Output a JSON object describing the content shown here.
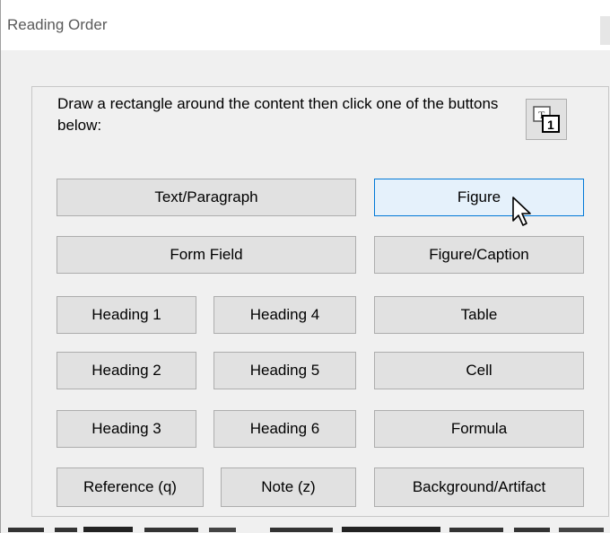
{
  "window": {
    "title": "Reading Order"
  },
  "instruction": "Draw a rectangle around the content then click one of the buttons below:",
  "mode_button": {
    "icon": "text-order-icon"
  },
  "buttons": {
    "text_paragraph": "Text/Paragraph",
    "figure": "Figure",
    "form_field": "Form Field",
    "figure_caption": "Figure/Caption",
    "heading_1": "Heading 1",
    "heading_4": "Heading 4",
    "table": "Table",
    "heading_2": "Heading 2",
    "heading_5": "Heading 5",
    "cell": "Cell",
    "heading_3": "Heading 3",
    "heading_6": "Heading 6",
    "formula": "Formula",
    "reference": "Reference (q)",
    "note": "Note (z)",
    "background_artifact": "Background/Artifact"
  },
  "colors": {
    "dialog_bg": "#f0f0f0",
    "button_bg": "#e1e1e1",
    "button_border": "#adadad",
    "hover_bg": "#e5f1fb",
    "hover_border": "#0078d7"
  }
}
